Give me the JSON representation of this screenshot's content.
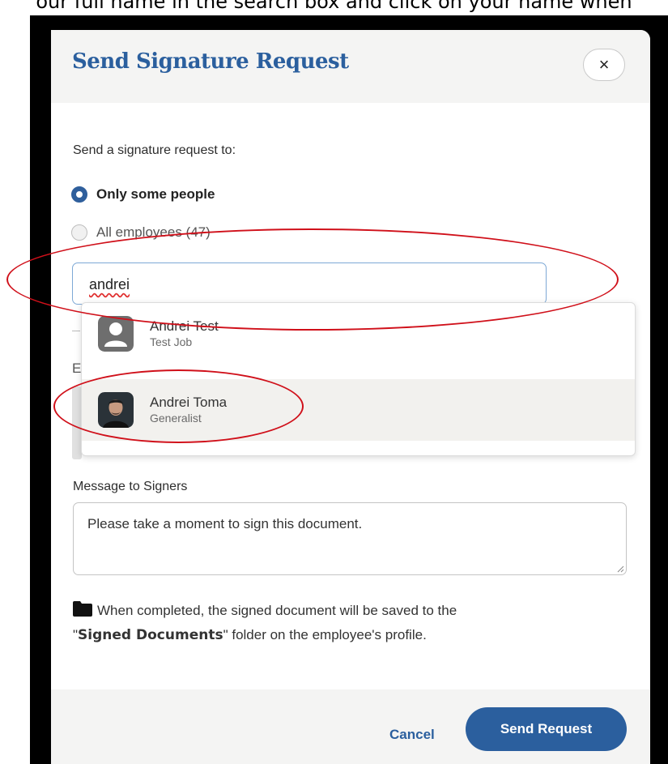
{
  "instruction_text": "our full name in the search box and click on your name when",
  "modal": {
    "title": "Send Signature Request",
    "close_label": "×"
  },
  "form": {
    "intro": "Send a signature request to:",
    "options": [
      {
        "label": "Only some people",
        "selected": true
      },
      {
        "label": "All employees (47)",
        "selected": false
      }
    ],
    "search_value": "andrei",
    "underlying_letter": "E"
  },
  "dropdown": {
    "items": [
      {
        "name": "Andrei Test",
        "job": "Test Job",
        "avatar": "user-placeholder-icon",
        "highlighted": false
      },
      {
        "name": "Andrei Toma",
        "job": "Generalist",
        "avatar": "user-photo",
        "highlighted": true
      }
    ]
  },
  "message": {
    "label": "Message to Signers",
    "value": "Please take a moment to sign this document."
  },
  "note": {
    "icon": "folder-icon",
    "text_before": "When completed, the signed document will be saved to the",
    "quote_open": "\"",
    "folder_name": "Signed Documents",
    "quote_close": "\"",
    "text_after": " folder on the employee's profile."
  },
  "footer": {
    "cancel_label": "Cancel",
    "send_label": "Send Request"
  },
  "colors": {
    "brand_blue": "#2b5f9e",
    "annotation_red": "#d0101a",
    "header_bg": "#f4f4f3"
  }
}
